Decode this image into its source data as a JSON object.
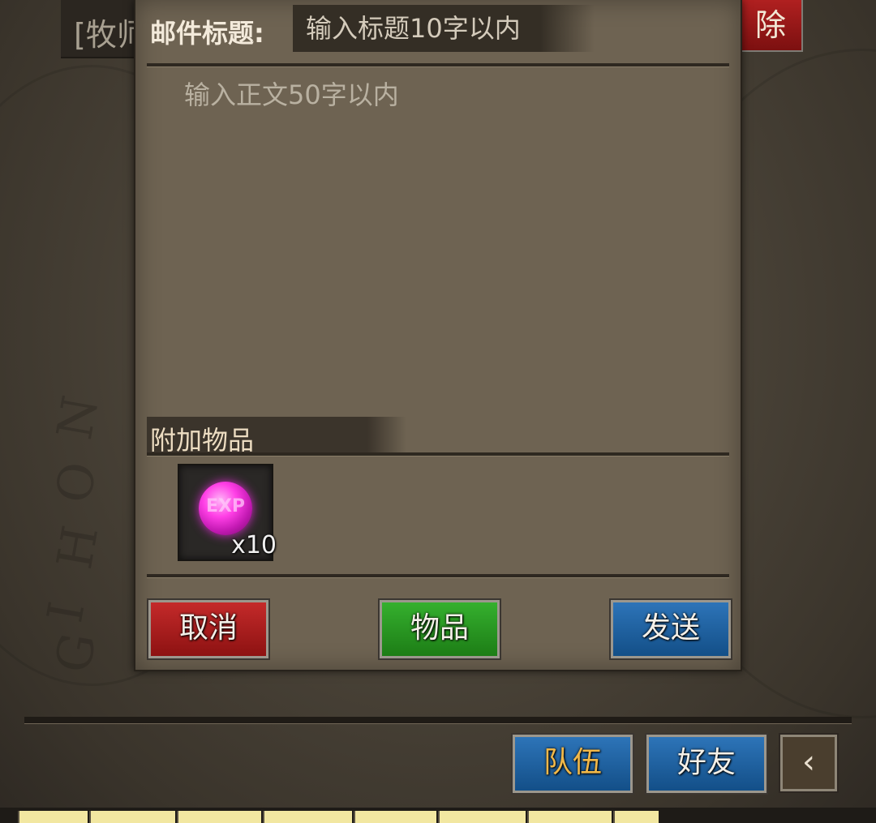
{
  "background_list": {
    "row_preview": "[牧师",
    "delete_label": "除"
  },
  "compose": {
    "title_label": "邮件标题:",
    "title_placeholder": "输入标题10字以内",
    "title_value": "",
    "body_placeholder": "输入正文50字以内",
    "body_value": "",
    "attachment_header": "附加物品",
    "attachments": [
      {
        "icon": "exp-orb-icon",
        "icon_text": "EXP",
        "quantity": "x10",
        "color": "#ff3fe6"
      }
    ],
    "buttons": {
      "cancel": "取消",
      "items": "物品",
      "send": "发送"
    }
  },
  "bottom_nav": {
    "team": "队伍",
    "friends": "好友",
    "back_icon": "chevron-left-icon"
  },
  "colors": {
    "red_button": "#b02020",
    "green_button": "#2a9a22",
    "blue_button": "#1f64a4",
    "team_text": "#f0b84a"
  }
}
